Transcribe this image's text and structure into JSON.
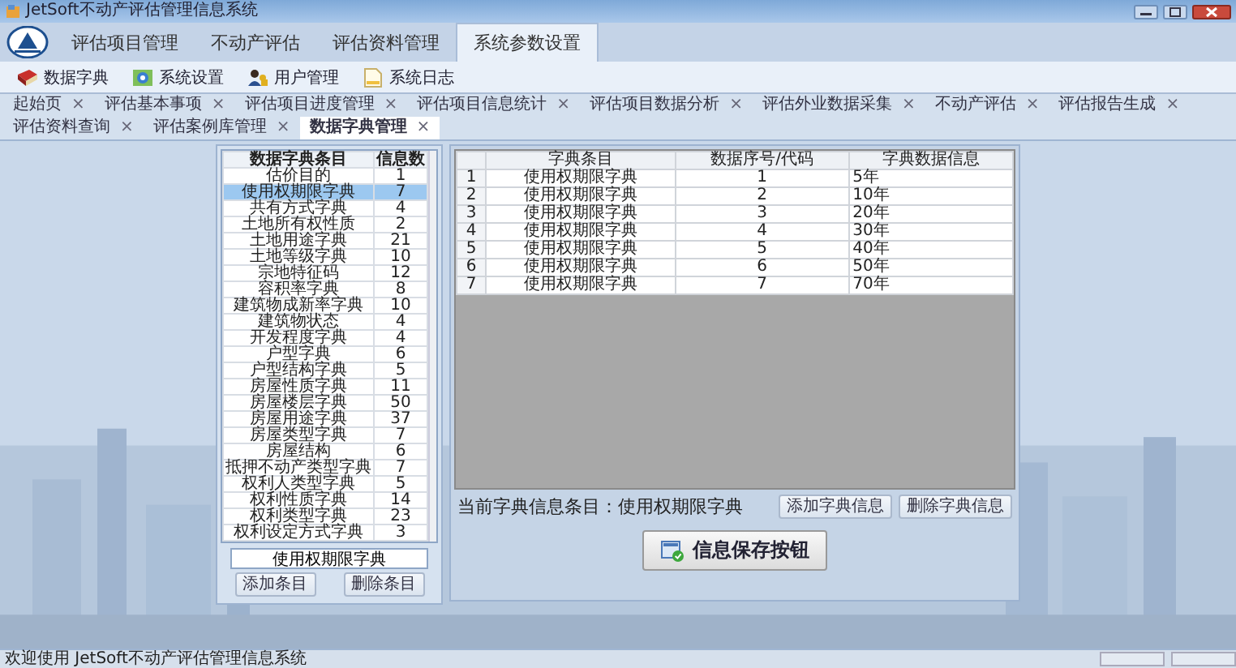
{
  "window": {
    "title": "JetSoft不动产评估管理信息系统"
  },
  "menu_tabs": [
    {
      "label": "评估项目管理",
      "selected": false
    },
    {
      "label": "不动产评估",
      "selected": false
    },
    {
      "label": "评估资料管理",
      "selected": false
    },
    {
      "label": "系统参数设置",
      "selected": true
    }
  ],
  "toolbar": [
    {
      "label": "数据字典",
      "kind": "book"
    },
    {
      "label": "系统设置",
      "kind": "settings"
    },
    {
      "label": "用户管理",
      "kind": "users"
    },
    {
      "label": "系统日志",
      "kind": "log"
    }
  ],
  "doc_tabs": [
    {
      "label": "起始页",
      "close": "×",
      "selected": false
    },
    {
      "label": "评估基本事项",
      "close": "×",
      "selected": false
    },
    {
      "label": "评估项目进度管理",
      "close": "×",
      "selected": false
    },
    {
      "label": "评估项目信息统计",
      "close": "×",
      "selected": false
    },
    {
      "label": "评估项目数据分析",
      "close": "×",
      "selected": false
    },
    {
      "label": "评估外业数据采集",
      "close": "×",
      "selected": false
    },
    {
      "label": "不动产评估",
      "close": "×",
      "selected": false
    },
    {
      "label": "评估报告生成",
      "close": "×",
      "selected": false
    },
    {
      "label": "评估资料查询",
      "close": "×",
      "selected": false
    },
    {
      "label": "评估案例库管理",
      "close": "×",
      "selected": false
    },
    {
      "label": "数据字典管理",
      "close": "×",
      "selected": true
    }
  ],
  "dict_list": {
    "columns": [
      "数据字典条目",
      "信息数"
    ],
    "rows": [
      {
        "name": "估价目的",
        "count": "1",
        "selected": false
      },
      {
        "name": "使用权期限字典",
        "count": "7",
        "selected": true
      },
      {
        "name": "共有方式字典",
        "count": "4",
        "selected": false
      },
      {
        "name": "土地所有权性质",
        "count": "2",
        "selected": false
      },
      {
        "name": "土地用途字典",
        "count": "21",
        "selected": false
      },
      {
        "name": "土地等级字典",
        "count": "10",
        "selected": false
      },
      {
        "name": "宗地特征码",
        "count": "12",
        "selected": false
      },
      {
        "name": "容积率字典",
        "count": "8",
        "selected": false
      },
      {
        "name": "建筑物成新率字典",
        "count": "10",
        "selected": false
      },
      {
        "name": "建筑物状态",
        "count": "4",
        "selected": false
      },
      {
        "name": "开发程度字典",
        "count": "4",
        "selected": false
      },
      {
        "name": "户型字典",
        "count": "6",
        "selected": false
      },
      {
        "name": "户型结构字典",
        "count": "5",
        "selected": false
      },
      {
        "name": "房屋性质字典",
        "count": "11",
        "selected": false
      },
      {
        "name": "房屋楼层字典",
        "count": "50",
        "selected": false
      },
      {
        "name": "房屋用途字典",
        "count": "37",
        "selected": false
      },
      {
        "name": "房屋类型字典",
        "count": "7",
        "selected": false
      },
      {
        "name": "房屋结构",
        "count": "6",
        "selected": false
      },
      {
        "name": "抵押不动产类型字典",
        "count": "7",
        "selected": false
      },
      {
        "name": "权利人类型字典",
        "count": "5",
        "selected": false
      },
      {
        "name": "权利性质字典",
        "count": "14",
        "selected": false
      },
      {
        "name": "权利类型字典",
        "count": "23",
        "selected": false
      },
      {
        "name": "权利设定方式字典",
        "count": "3",
        "selected": false
      }
    ],
    "current_value": "使用权期限字典",
    "buttons": [
      "添加条目",
      "删除条目"
    ]
  },
  "data_table": {
    "columns": [
      "字典条目",
      "数据序号/代码",
      "字典数据信息"
    ],
    "rows": [
      {
        "index": "1",
        "item": "使用权期限字典",
        "code": "1",
        "info": "5年"
      },
      {
        "index": "2",
        "item": "使用权期限字典",
        "code": "2",
        "info": "10年"
      },
      {
        "index": "3",
        "item": "使用权期限字典",
        "code": "3",
        "info": "20年"
      },
      {
        "index": "4",
        "item": "使用权期限字典",
        "code": "4",
        "info": "30年"
      },
      {
        "index": "5",
        "item": "使用权期限字典",
        "code": "5",
        "info": "40年"
      },
      {
        "index": "6",
        "item": "使用权期限字典",
        "code": "6",
        "info": "50年"
      },
      {
        "index": "7",
        "item": "使用权期限字典",
        "code": "7",
        "info": "70年"
      }
    ]
  },
  "current_entry": "当前字典信息条目：使用权期限字典",
  "entry_buttons": [
    "添加字典信息",
    "删除字典信息"
  ],
  "save_button": "信息保存按钮",
  "status_bar": "欢迎使用 JetSoft不动产评估管理信息系统"
}
